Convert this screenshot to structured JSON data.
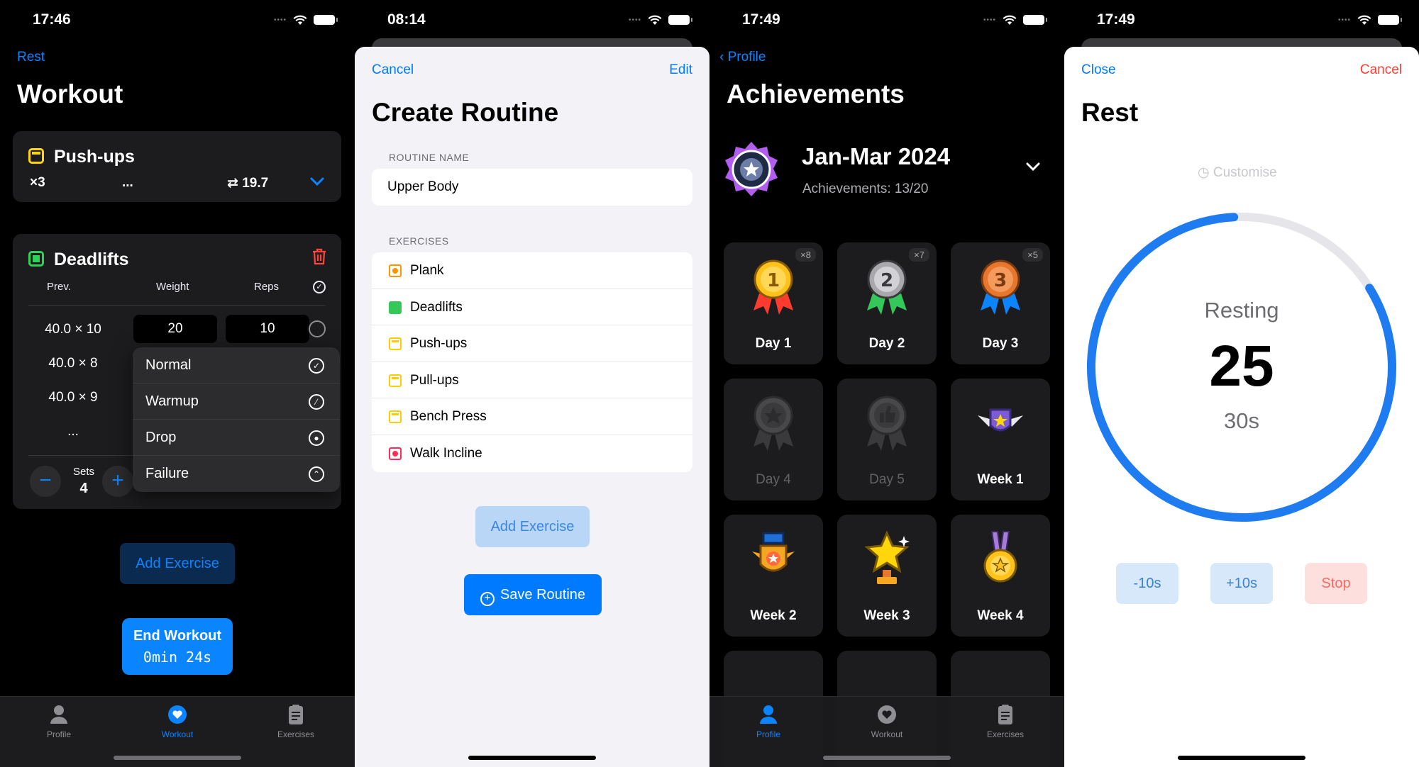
{
  "screen1": {
    "status_time": "17:46",
    "nav_link": "Rest",
    "title": "Workout",
    "pushups": {
      "name": "Push-ups",
      "sets": "×3",
      "dots": "...",
      "volume": "19.7"
    },
    "deadlifts": {
      "name": "Deadlifts",
      "headers": {
        "prev": "Prev.",
        "weight": "Weight",
        "reps": "Reps"
      },
      "rows": [
        {
          "prev": "40.0 × 10",
          "weight": "20",
          "reps": "10"
        },
        {
          "prev": "40.0 × 8"
        },
        {
          "prev": "40.0 × 9"
        },
        {
          "prev": "..."
        }
      ]
    },
    "set_type_menu": [
      "Normal",
      "Warmup",
      "Drop",
      "Failure"
    ],
    "sets_label": "Sets",
    "sets_value": "4",
    "add_exercise": "Add Exercise",
    "end_workout": "End Workout",
    "end_timer": "0min 24s"
  },
  "screen2": {
    "status_time": "08:14",
    "cancel": "Cancel",
    "edit": "Edit",
    "title": "Create Routine",
    "routine_name_label": "ROUTINE NAME",
    "routine_name_value": "Upper Body",
    "exercises_label": "EXERCISES",
    "exercises": [
      {
        "name": "Plank",
        "color": "#ff9500"
      },
      {
        "name": "Deadlifts",
        "color": "#34c759"
      },
      {
        "name": "Push-ups",
        "color": "#ffcc00"
      },
      {
        "name": "Pull-ups",
        "color": "#ffcc00"
      },
      {
        "name": "Bench Press",
        "color": "#ffcc00"
      },
      {
        "name": "Walk Incline",
        "color": "#ff2d55"
      }
    ],
    "add_exercise": "Add Exercise",
    "save_routine": "Save Routine"
  },
  "screen3": {
    "status_time": "17:49",
    "back": "Profile",
    "title": "Achievements",
    "period": "Jan-Mar 2024",
    "achievements_count": "Achievements: 13/20",
    "tiles": [
      {
        "label": "Day 1",
        "count": "×8",
        "locked": false,
        "art": "gold-medal"
      },
      {
        "label": "Day 2",
        "count": "×7",
        "locked": false,
        "art": "silver-medal"
      },
      {
        "label": "Day 3",
        "count": "×5",
        "locked": false,
        "art": "bronze-medal"
      },
      {
        "label": "Day 4",
        "count": "",
        "locked": true,
        "art": "star-medal"
      },
      {
        "label": "Day 5",
        "count": "",
        "locked": true,
        "art": "thumbs-medal"
      },
      {
        "label": "Week 1",
        "count": "",
        "locked": false,
        "art": "winged-shield"
      },
      {
        "label": "Week 2",
        "count": "",
        "locked": false,
        "art": "shield-badge"
      },
      {
        "label": "Week 3",
        "count": "",
        "locked": false,
        "art": "star-trophy"
      },
      {
        "label": "Week 4",
        "count": "",
        "locked": false,
        "art": "purple-medal"
      }
    ]
  },
  "screen4": {
    "status_time": "17:49",
    "close": "Close",
    "cancel": "Cancel",
    "title": "Rest",
    "customise": "Customise",
    "resting": "Resting",
    "seconds_left": "25",
    "total": "30s",
    "progress_remaining": 0.83,
    "minus": "-10s",
    "plus": "+10s",
    "stop": "Stop"
  },
  "tabs": [
    "Profile",
    "Workout",
    "Exercises"
  ],
  "colors": {
    "accent": "#0a84ff",
    "danger": "#ff3b30"
  }
}
